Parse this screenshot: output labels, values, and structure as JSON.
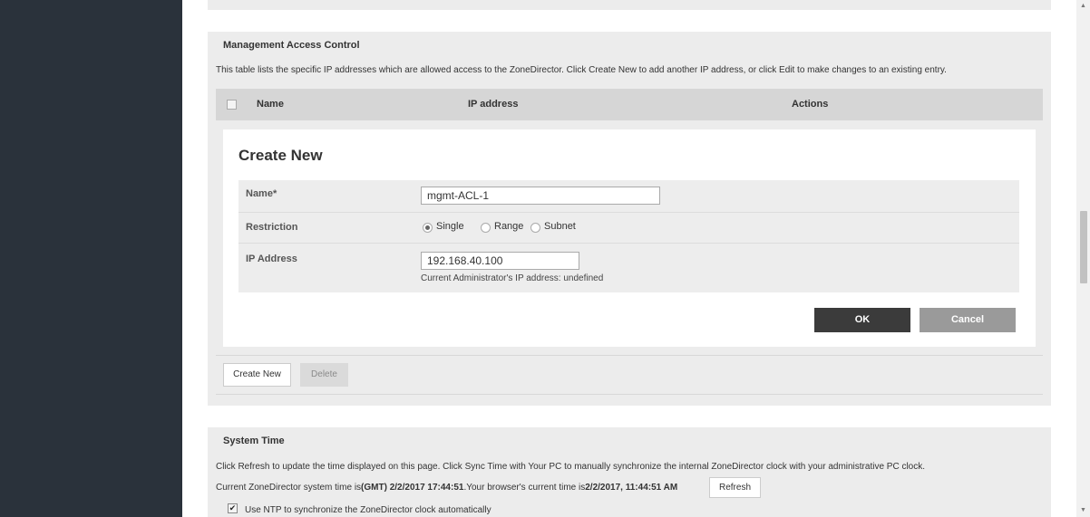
{
  "management": {
    "title": "Management Access Control",
    "description": "This table lists the specific IP addresses which are allowed access to the ZoneDirector. Click Create New to add another IP address, or click Edit to make changes to an existing entry.",
    "columns": {
      "name": "Name",
      "ip": "IP address",
      "actions": "Actions"
    },
    "create_new": {
      "title": "Create New",
      "name_label": "Name*",
      "name_value": "mgmt-ACL-1",
      "restriction_label": "Restriction",
      "restriction_options": [
        "Single",
        "Range",
        "Subnet"
      ],
      "restriction_selected": "Single",
      "ip_label": "IP Address",
      "ip_value": "192.168.40.100",
      "ip_hint": "Current Administrator's IP address: undefined",
      "ok_label": "OK",
      "cancel_label": "Cancel"
    },
    "create_button": "Create New",
    "delete_button": "Delete"
  },
  "system_time": {
    "title": "System Time",
    "description": "Click Refresh to update the time displayed on this page. Click Sync Time with Your PC to manually synchronize the internal ZoneDirector clock with your administrative PC clock.",
    "zd_time_prefix": "Current ZoneDirector system time is",
    "zd_time_value": "(GMT) 2/2/2017 17:44:51",
    "browser_time_prefix": ".Your browser's current time is",
    "browser_time_value": "2/2/2017, 11:44:51 AM",
    "refresh_button": "Refresh",
    "ntp_label": "Use NTP to synchronize the ZoneDirector clock automatically",
    "ntp_checked": true
  },
  "colors": {
    "sidebar": "#2a323b",
    "ok_button": "#3b3b3b",
    "cancel_button": "#9a9a9a"
  }
}
